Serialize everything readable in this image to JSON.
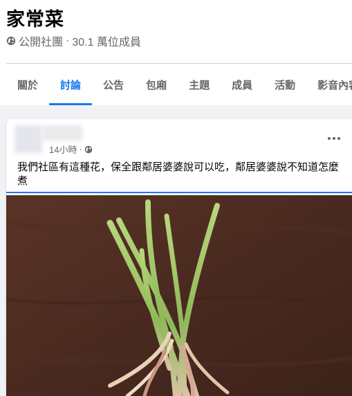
{
  "group": {
    "name": "家常菜",
    "privacy": "公開社團",
    "members": "30.1 萬位成員"
  },
  "tabs": [
    {
      "label": "關於"
    },
    {
      "label": "討論"
    },
    {
      "label": "公告"
    },
    {
      "label": "包廂"
    },
    {
      "label": "主題"
    },
    {
      "label": "成員"
    },
    {
      "label": "活動"
    },
    {
      "label": "影音內容"
    }
  ],
  "active_tab": "討論",
  "post": {
    "time": "14小時",
    "text_line_1": "我們社區有這種花，保全跟鄰居婆婆說可以吃，鄰居婆婆說不知道怎麼",
    "text_line_2": "煮"
  },
  "colors": {
    "accent": "#1877f2",
    "secondary_text": "#65676b",
    "page_background": "#f0f2f5",
    "photo_background": "#4a2a20"
  },
  "icons": {
    "privacy": "globe-icon",
    "audience": "globe-icon",
    "menu": "more-options-icon"
  }
}
